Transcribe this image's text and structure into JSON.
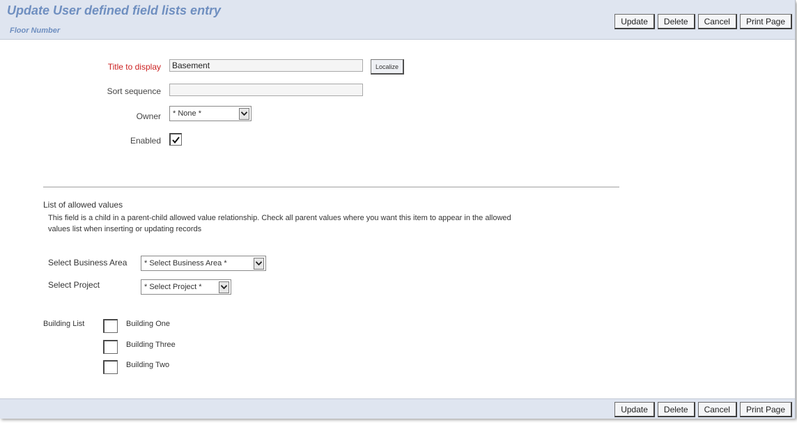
{
  "header": {
    "title": "Update User defined field lists entry",
    "subtitle": "Floor Number"
  },
  "actions": {
    "update": "Update",
    "delete": "Delete",
    "cancel": "Cancel",
    "print": "Print Page"
  },
  "form": {
    "title_label": "Title to display",
    "title_value": "Basement",
    "localize_label": "Localize",
    "sort_label": "Sort sequence",
    "sort_value": "",
    "owner_label": "Owner",
    "owner_value": "* None *",
    "enabled_label": "Enabled",
    "enabled_checked": true
  },
  "allowed": {
    "heading": "List of allowed values",
    "description_line1": "This field is a child in a parent-child allowed value relationship. Check all parent values where you want this item to appear in the allowed",
    "description_line2": "values list when inserting or updating records",
    "business_area_label": "Select Business Area",
    "business_area_value": "* Select Business Area *",
    "project_label": "Select Project",
    "project_value": "* Select Project *",
    "building_list_label": "Building List",
    "buildings": [
      {
        "label": "Building One",
        "checked": false
      },
      {
        "label": "Building Three",
        "checked": false
      },
      {
        "label": "Building Two",
        "checked": false
      }
    ]
  },
  "icons": {
    "dropdown": "chevron-down-icon",
    "check": "checkmark-icon"
  },
  "colors": {
    "header_bg": "#dfe5f0",
    "title": "#6f8fc0",
    "required_label": "#cc2222"
  }
}
